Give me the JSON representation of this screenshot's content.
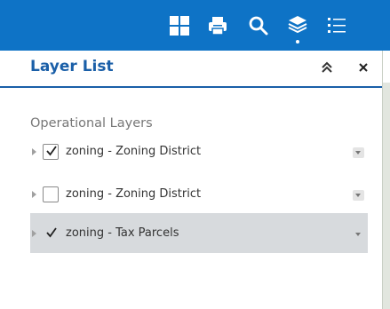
{
  "toolbar": {
    "icons": [
      "grid-icon",
      "print-icon",
      "search-icon",
      "layers-icon",
      "list-icon"
    ],
    "background": "#0e73c6",
    "active": "layers-icon"
  },
  "panel": {
    "title": "Layer List",
    "title_color": "#1a5fa8",
    "section_label": "Operational Layers",
    "layers": [
      {
        "label": "zoning - Zoning District",
        "checked": true
      },
      {
        "label": "zoning - Zoning District",
        "checked": false
      },
      {
        "label": "zoning - Tax Parcels",
        "checked": true,
        "selected": true
      }
    ]
  }
}
